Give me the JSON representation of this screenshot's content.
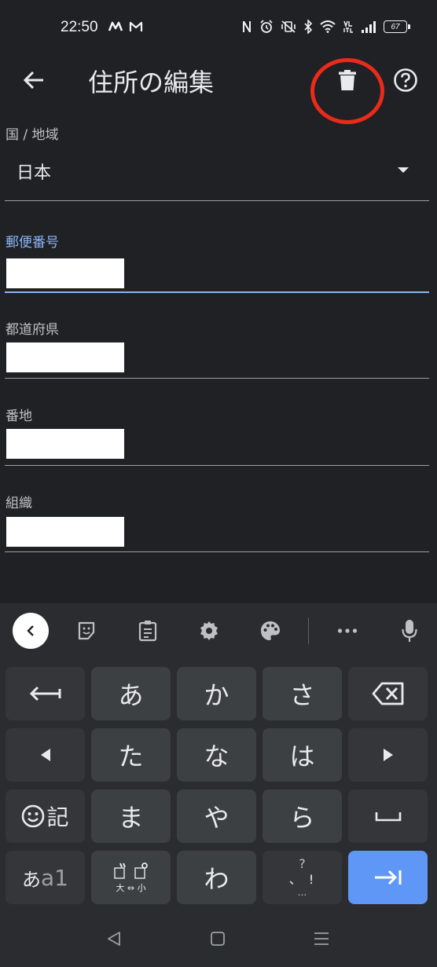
{
  "status_bar": {
    "time": "22:50",
    "battery_level": "67"
  },
  "app_bar": {
    "title": "住所の編集",
    "highlight_color": "#ea2a1b"
  },
  "form": {
    "country": {
      "label": "国 / 地域",
      "value": "日本"
    },
    "postal_code": {
      "label": "郵便番号",
      "value": ""
    },
    "prefecture": {
      "label": "都道府県",
      "value": ""
    },
    "address_line": {
      "label": "番地",
      "value": ""
    },
    "organization": {
      "label": "組織",
      "value": ""
    }
  },
  "keyboard": {
    "toolbar": [
      "chevron-left-icon",
      "sticker-icon",
      "clipboard-icon",
      "settings-icon",
      "palette-icon",
      "more-icon",
      "mic-icon"
    ],
    "rows": [
      [
        "⟵",
        "あ",
        "か",
        "さ",
        "⌫"
      ],
      [
        "◀",
        "た",
        "な",
        "は",
        "▶"
      ],
      [
        "☺記",
        "ま",
        "や",
        "ら",
        "␣"
      ],
      [
        "あa1",
        "゛゜",
        "わ",
        "、。?!",
        "→|"
      ]
    ],
    "key_1_0": "あ",
    "key_1_1": "か",
    "key_1_2": "さ",
    "key_2_0": "た",
    "key_2_1": "な",
    "key_2_2": "は",
    "key_3_0": "ま",
    "key_3_1": "や",
    "key_3_2": "ら",
    "key_4_2": "わ",
    "emoji_key_label": "記",
    "mode_key_label_a": "あ",
    "mode_key_label_b": "a1",
    "dakuten_caption": "大 ⇔ 小",
    "punct_top": "?",
    "punct_mid": "、 !",
    "punct_bottom": "...",
    "accent_color": "#5e97f6"
  },
  "nav_bar": {
    "buttons": [
      "back-triangle-icon",
      "home-square-icon",
      "recents-icon"
    ]
  }
}
